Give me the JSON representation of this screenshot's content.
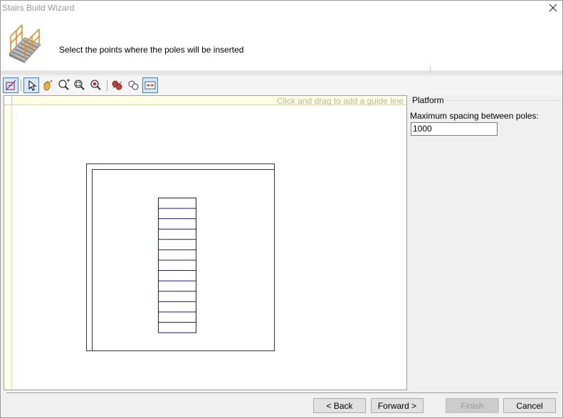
{
  "window": {
    "title": "Stairs Build Wizard"
  },
  "header": {
    "instruction": "Select the points where the poles will be inserted",
    "icon": "stairs-icon"
  },
  "toolbar": {
    "tools": [
      {
        "name": "toggle-view-icon",
        "selected": true
      },
      {
        "name": "pointer-icon",
        "selected": true
      },
      {
        "name": "pan-hand-icon",
        "selected": false
      },
      {
        "name": "zoom-in-out-icon",
        "selected": false
      },
      {
        "name": "zoom-window-icon",
        "selected": false
      },
      {
        "name": "zoom-extents-icon",
        "selected": false
      },
      {
        "name": "add-pole-icon",
        "selected": false
      },
      {
        "name": "select-poles-icon",
        "selected": false
      },
      {
        "name": "fit-width-icon",
        "selected": true
      }
    ]
  },
  "canvas": {
    "guide_hint": "Click and drag to add a guide line",
    "stair_steps": 13
  },
  "platform": {
    "group_label": "Platform",
    "spacing_label": "Maximum spacing between poles:",
    "spacing_value": "1000"
  },
  "buttons": {
    "back": "< Back",
    "forward": "Forward >",
    "finish": "Finish",
    "cancel": "Cancel"
  },
  "colors": {
    "stair_lines": "#1a1a6e",
    "ruler_bg": "#ffffe6",
    "selected_tool_border": "#3a7fd1"
  }
}
